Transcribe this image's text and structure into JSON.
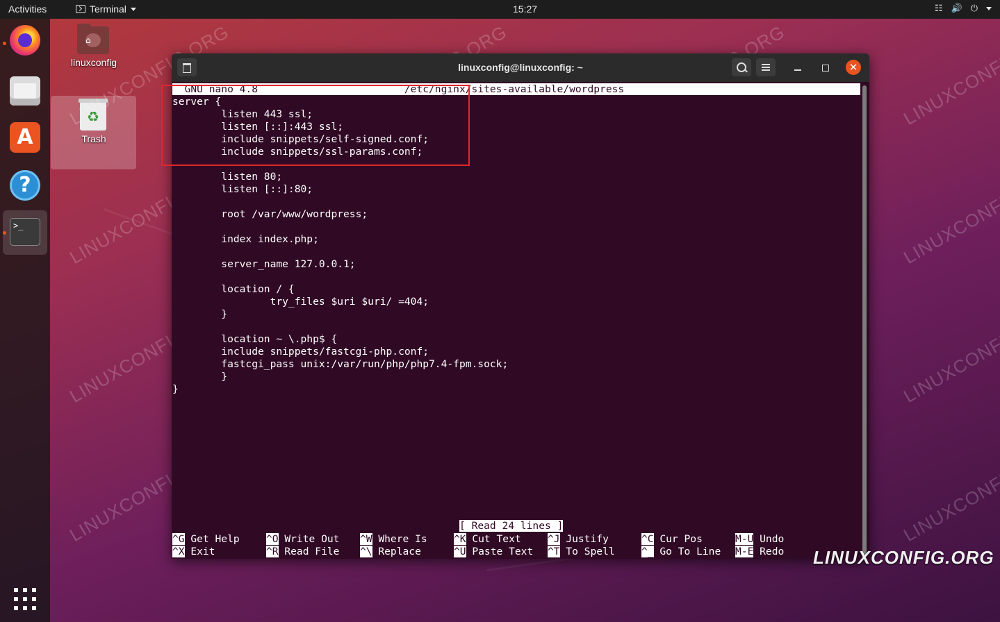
{
  "topbar": {
    "activities": "Activities",
    "app_name": "Terminal",
    "clock": "15:27",
    "tray_icons": [
      "network-icon",
      "volume-icon",
      "power-icon"
    ]
  },
  "dock": {
    "items": [
      "firefox",
      "files",
      "ubuntu-software",
      "help",
      "terminal"
    ],
    "apps_grid": "show-applications"
  },
  "desktop": {
    "home_label": "linuxconfig",
    "trash_label": "Trash"
  },
  "watermark": {
    "text": "LINUXCONFIG.ORG",
    "logo": "LINUXCONFIG.ORG"
  },
  "window": {
    "title": "linuxconfig@linuxconfig: ~"
  },
  "nano": {
    "header": "  GNU nano 4.8                        /etc/nginx/sites-available/wordpress",
    "lines": [
      "server {",
      "        listen 443 ssl;",
      "        listen [::]:443 ssl;",
      "        include snippets/self-signed.conf;",
      "        include snippets/ssl-params.conf;",
      "",
      "        listen 80;",
      "        listen [::]:80;",
      "",
      "        root /var/www/wordpress;",
      "",
      "        index index.php;",
      "",
      "        server_name 127.0.0.1;",
      "",
      "        location / {",
      "                try_files $uri $uri/ =404;",
      "        }",
      "",
      "        location ~ \\.php$ {",
      "        include snippets/fastcgi-php.conf;",
      "        fastcgi_pass unix:/var/run/php/php7.4-fpm.sock;",
      "        }",
      "}"
    ],
    "status": "[ Read 24 lines ]",
    "shortcuts_row1": [
      {
        "key": "^G",
        "label": "Get Help"
      },
      {
        "key": "^O",
        "label": "Write Out"
      },
      {
        "key": "^W",
        "label": "Where Is"
      },
      {
        "key": "^K",
        "label": "Cut Text"
      },
      {
        "key": "^J",
        "label": "Justify"
      },
      {
        "key": "^C",
        "label": "Cur Pos"
      },
      {
        "key": "M-U",
        "label": "Undo"
      }
    ],
    "shortcuts_row2": [
      {
        "key": "^X",
        "label": "Exit"
      },
      {
        "key": "^R",
        "label": "Read File"
      },
      {
        "key": "^\\",
        "label": "Replace"
      },
      {
        "key": "^U",
        "label": "Paste Text"
      },
      {
        "key": "^T",
        "label": "To Spell"
      },
      {
        "key": "^_",
        "label": "Go To Line"
      },
      {
        "key": "M-E",
        "label": "Redo"
      }
    ]
  },
  "colors": {
    "terminal_bg": "#300a24",
    "accent": "#e95420",
    "highlight_box": "#e0262b"
  }
}
